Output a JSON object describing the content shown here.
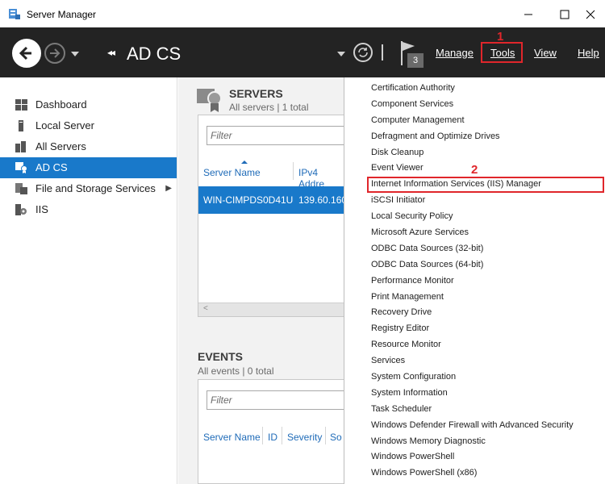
{
  "window": {
    "title": "Server Manager"
  },
  "nav": {
    "breadcrumb_arrows": "◂◂",
    "page_title": "AD CS",
    "notification_count": "3",
    "menus": {
      "manage": "Manage",
      "tools": "Tools",
      "view": "View",
      "help": "Help"
    }
  },
  "sidebar": {
    "items": [
      {
        "label": "Dashboard",
        "icon": "dashboard-icon"
      },
      {
        "label": "Local Server",
        "icon": "server-icon"
      },
      {
        "label": "All Servers",
        "icon": "servers-icon"
      },
      {
        "label": "AD CS",
        "icon": "certificate-icon",
        "active": true
      },
      {
        "label": "File and Storage Services",
        "icon": "storage-icon",
        "expandable": true
      },
      {
        "label": "IIS",
        "icon": "iis-icon"
      }
    ]
  },
  "servers": {
    "heading": "SERVERS",
    "subtitle": "All servers | 1 total",
    "filter_placeholder": "Filter",
    "columns": [
      "Server Name",
      "IPv4 Addre"
    ],
    "rows": [
      {
        "name": "WIN-CIMPDS0D41U",
        "ip": "139.60.160"
      }
    ]
  },
  "events": {
    "heading": "EVENTS",
    "subtitle": "All events | 0 total",
    "filter_placeholder": "Filter",
    "columns": [
      "Server Name",
      "ID",
      "Severity",
      "So"
    ]
  },
  "tools_menu": {
    "items": [
      "Certification Authority",
      "Component Services",
      "Computer Management",
      "Defragment and Optimize Drives",
      "Disk Cleanup",
      "Event Viewer",
      "Internet Information Services (IIS) Manager",
      "iSCSI Initiator",
      "Local Security Policy",
      "Microsoft Azure Services",
      "ODBC Data Sources (32-bit)",
      "ODBC Data Sources (64-bit)",
      "Performance Monitor",
      "Print Management",
      "Recovery Drive",
      "Registry Editor",
      "Resource Monitor",
      "Services",
      "System Configuration",
      "System Information",
      "Task Scheduler",
      "Windows Defender Firewall with Advanced Security",
      "Windows Memory Diagnostic",
      "Windows PowerShell",
      "Windows PowerShell (x86)"
    ],
    "highlighted_index": 6
  },
  "annotations": {
    "step1": "1",
    "step2": "2"
  },
  "colors": {
    "accent": "#1979ca",
    "nav_bg": "#232323",
    "highlight": "#e0262b"
  }
}
